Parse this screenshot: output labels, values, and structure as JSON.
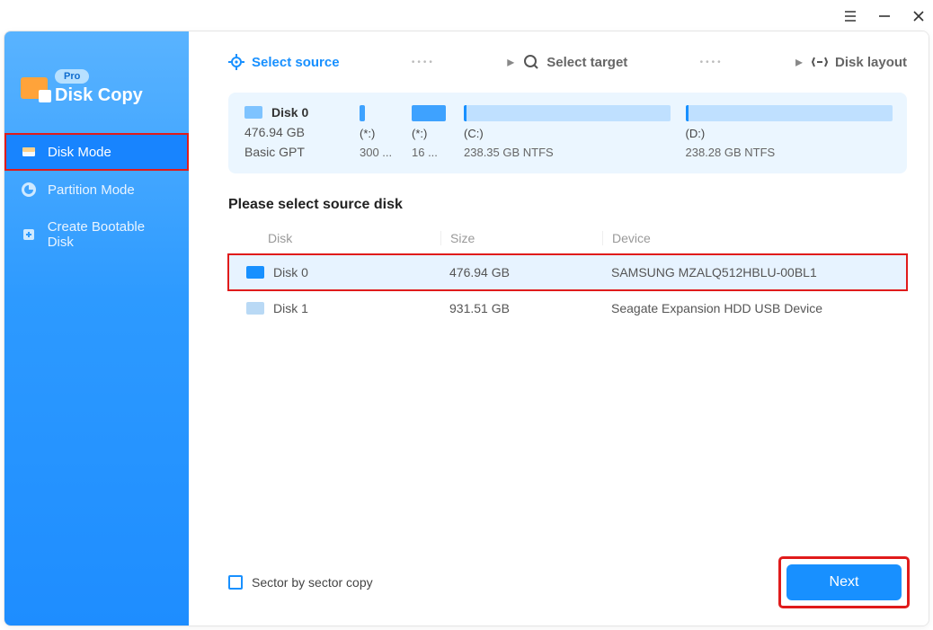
{
  "app": {
    "name": "Disk Copy",
    "edition": "Pro"
  },
  "sidebar": {
    "items": [
      {
        "label": "Disk Mode"
      },
      {
        "label": "Partition Mode"
      },
      {
        "label": "Create Bootable Disk"
      }
    ]
  },
  "steps": {
    "source": "Select source",
    "target": "Select target",
    "layout": "Disk layout"
  },
  "overview": {
    "disk_name": "Disk 0",
    "disk_size": "476.94 GB",
    "disk_type": "Basic GPT",
    "partitions": [
      {
        "letter": "(*:)",
        "info": "300 ..."
      },
      {
        "letter": "(*:)",
        "info": "16 ..."
      },
      {
        "letter": "(C:)",
        "info": "238.35 GB NTFS"
      },
      {
        "letter": "(D:)",
        "info": "238.28 GB NTFS"
      }
    ]
  },
  "prompt": "Please select source disk",
  "table": {
    "headers": {
      "disk": "Disk",
      "size": "Size",
      "device": "Device"
    },
    "rows": [
      {
        "name": "Disk 0",
        "size": "476.94 GB",
        "device": "SAMSUNG MZALQ512HBLU-00BL1"
      },
      {
        "name": "Disk 1",
        "size": "931.51 GB",
        "device": "Seagate  Expansion HDD   USB Device"
      }
    ]
  },
  "footer": {
    "sector_label": "Sector by sector copy",
    "next": "Next"
  }
}
